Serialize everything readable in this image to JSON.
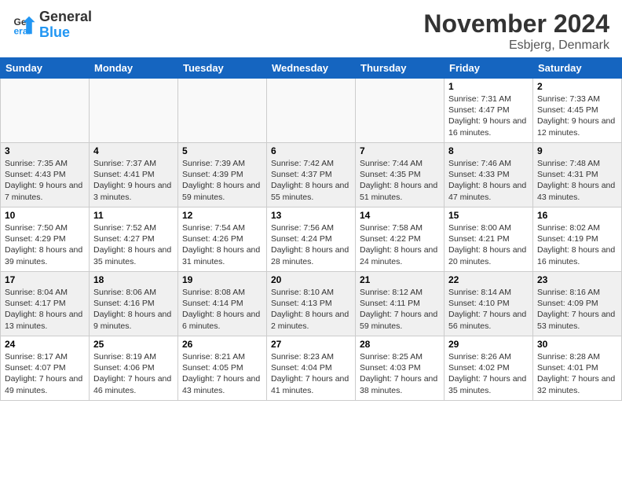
{
  "header": {
    "logo_general": "General",
    "logo_blue": "Blue",
    "month_title": "November 2024",
    "location": "Esbjerg, Denmark"
  },
  "weekdays": [
    "Sunday",
    "Monday",
    "Tuesday",
    "Wednesday",
    "Thursday",
    "Friday",
    "Saturday"
  ],
  "weeks": [
    [
      {
        "day": "",
        "info": ""
      },
      {
        "day": "",
        "info": ""
      },
      {
        "day": "",
        "info": ""
      },
      {
        "day": "",
        "info": ""
      },
      {
        "day": "",
        "info": ""
      },
      {
        "day": "1",
        "info": "Sunrise: 7:31 AM\nSunset: 4:47 PM\nDaylight: 9 hours and 16 minutes."
      },
      {
        "day": "2",
        "info": "Sunrise: 7:33 AM\nSunset: 4:45 PM\nDaylight: 9 hours and 12 minutes."
      }
    ],
    [
      {
        "day": "3",
        "info": "Sunrise: 7:35 AM\nSunset: 4:43 PM\nDaylight: 9 hours and 7 minutes."
      },
      {
        "day": "4",
        "info": "Sunrise: 7:37 AM\nSunset: 4:41 PM\nDaylight: 9 hours and 3 minutes."
      },
      {
        "day": "5",
        "info": "Sunrise: 7:39 AM\nSunset: 4:39 PM\nDaylight: 8 hours and 59 minutes."
      },
      {
        "day": "6",
        "info": "Sunrise: 7:42 AM\nSunset: 4:37 PM\nDaylight: 8 hours and 55 minutes."
      },
      {
        "day": "7",
        "info": "Sunrise: 7:44 AM\nSunset: 4:35 PM\nDaylight: 8 hours and 51 minutes."
      },
      {
        "day": "8",
        "info": "Sunrise: 7:46 AM\nSunset: 4:33 PM\nDaylight: 8 hours and 47 minutes."
      },
      {
        "day": "9",
        "info": "Sunrise: 7:48 AM\nSunset: 4:31 PM\nDaylight: 8 hours and 43 minutes."
      }
    ],
    [
      {
        "day": "10",
        "info": "Sunrise: 7:50 AM\nSunset: 4:29 PM\nDaylight: 8 hours and 39 minutes."
      },
      {
        "day": "11",
        "info": "Sunrise: 7:52 AM\nSunset: 4:27 PM\nDaylight: 8 hours and 35 minutes."
      },
      {
        "day": "12",
        "info": "Sunrise: 7:54 AM\nSunset: 4:26 PM\nDaylight: 8 hours and 31 minutes."
      },
      {
        "day": "13",
        "info": "Sunrise: 7:56 AM\nSunset: 4:24 PM\nDaylight: 8 hours and 28 minutes."
      },
      {
        "day": "14",
        "info": "Sunrise: 7:58 AM\nSunset: 4:22 PM\nDaylight: 8 hours and 24 minutes."
      },
      {
        "day": "15",
        "info": "Sunrise: 8:00 AM\nSunset: 4:21 PM\nDaylight: 8 hours and 20 minutes."
      },
      {
        "day": "16",
        "info": "Sunrise: 8:02 AM\nSunset: 4:19 PM\nDaylight: 8 hours and 16 minutes."
      }
    ],
    [
      {
        "day": "17",
        "info": "Sunrise: 8:04 AM\nSunset: 4:17 PM\nDaylight: 8 hours and 13 minutes."
      },
      {
        "day": "18",
        "info": "Sunrise: 8:06 AM\nSunset: 4:16 PM\nDaylight: 8 hours and 9 minutes."
      },
      {
        "day": "19",
        "info": "Sunrise: 8:08 AM\nSunset: 4:14 PM\nDaylight: 8 hours and 6 minutes."
      },
      {
        "day": "20",
        "info": "Sunrise: 8:10 AM\nSunset: 4:13 PM\nDaylight: 8 hours and 2 minutes."
      },
      {
        "day": "21",
        "info": "Sunrise: 8:12 AM\nSunset: 4:11 PM\nDaylight: 7 hours and 59 minutes."
      },
      {
        "day": "22",
        "info": "Sunrise: 8:14 AM\nSunset: 4:10 PM\nDaylight: 7 hours and 56 minutes."
      },
      {
        "day": "23",
        "info": "Sunrise: 8:16 AM\nSunset: 4:09 PM\nDaylight: 7 hours and 53 minutes."
      }
    ],
    [
      {
        "day": "24",
        "info": "Sunrise: 8:17 AM\nSunset: 4:07 PM\nDaylight: 7 hours and 49 minutes."
      },
      {
        "day": "25",
        "info": "Sunrise: 8:19 AM\nSunset: 4:06 PM\nDaylight: 7 hours and 46 minutes."
      },
      {
        "day": "26",
        "info": "Sunrise: 8:21 AM\nSunset: 4:05 PM\nDaylight: 7 hours and 43 minutes."
      },
      {
        "day": "27",
        "info": "Sunrise: 8:23 AM\nSunset: 4:04 PM\nDaylight: 7 hours and 41 minutes."
      },
      {
        "day": "28",
        "info": "Sunrise: 8:25 AM\nSunset: 4:03 PM\nDaylight: 7 hours and 38 minutes."
      },
      {
        "day": "29",
        "info": "Sunrise: 8:26 AM\nSunset: 4:02 PM\nDaylight: 7 hours and 35 minutes."
      },
      {
        "day": "30",
        "info": "Sunrise: 8:28 AM\nSunset: 4:01 PM\nDaylight: 7 hours and 32 minutes."
      }
    ]
  ]
}
